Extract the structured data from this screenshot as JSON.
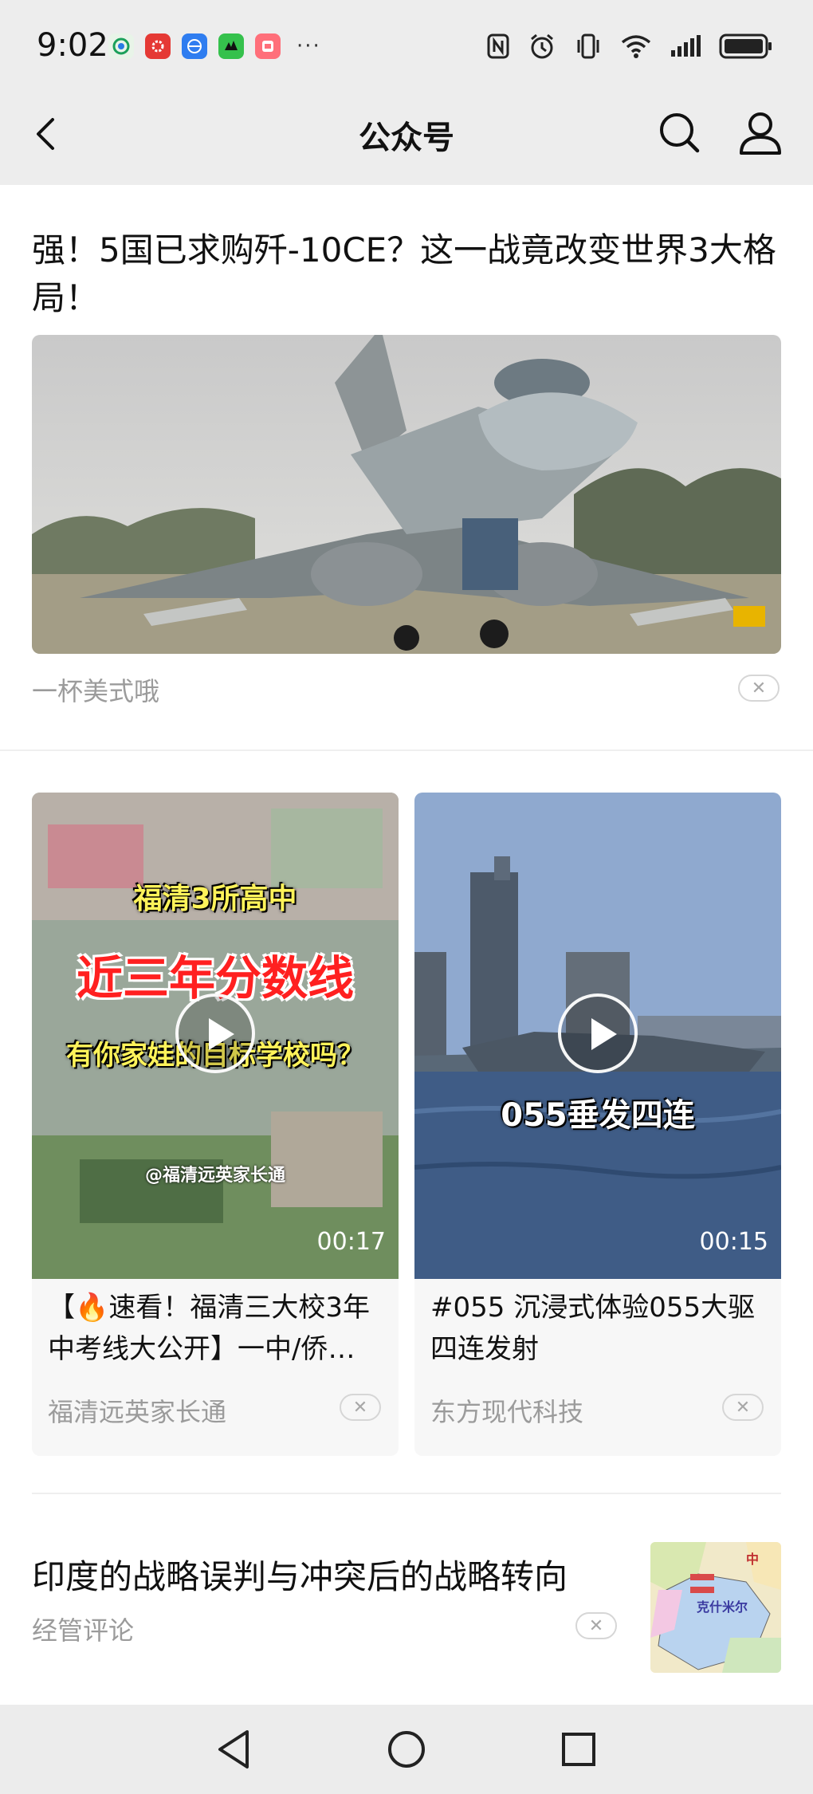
{
  "status_bar": {
    "time": "9:02",
    "more": "···",
    "icons": [
      "nfc-icon",
      "alarm-icon",
      "vibrate-icon",
      "wifi-icon",
      "signal-icon",
      "battery-icon"
    ],
    "apps": [
      "mobile-app-icon",
      "app-icon-red",
      "browser-app-icon",
      "app-icon-green",
      "app-icon-pink"
    ]
  },
  "nav": {
    "title": "公众号",
    "back_icon": "chevron-left-icon",
    "search_icon": "search-icon",
    "user_icon": "user-icon"
  },
  "feed": {
    "article1": {
      "title": "强！5国已求购歼-10CE？这一战竟改变世界3大格局！",
      "source": "一杯美式哦"
    },
    "videos": [
      {
        "overlay_line1": "福清3所高中",
        "overlay_line2": "近三年分数线",
        "overlay_line3": "有你家娃的目标学校吗？",
        "overlay_line4": "@福清远英家长通",
        "duration": "00:17",
        "title": "【🔥速看！福清三大校3年中考线大公开】一中/侨…",
        "source": "福清远英家长通"
      },
      {
        "overlay_line1": "055垂发四连",
        "duration": "00:15",
        "title": "#055 沉浸式体验055大驱四连发射",
        "source": "东方现代科技"
      }
    ],
    "article3": {
      "title": "印度的战略误判与冲突后的战略转向",
      "source": "经管评论",
      "map_label_1": "克什米尔",
      "map_label_2": "中"
    }
  },
  "close_glyph": "✕",
  "colors": {
    "background": "#ededed",
    "card": "#ffffff",
    "secondary_text": "#9b9b9b"
  }
}
